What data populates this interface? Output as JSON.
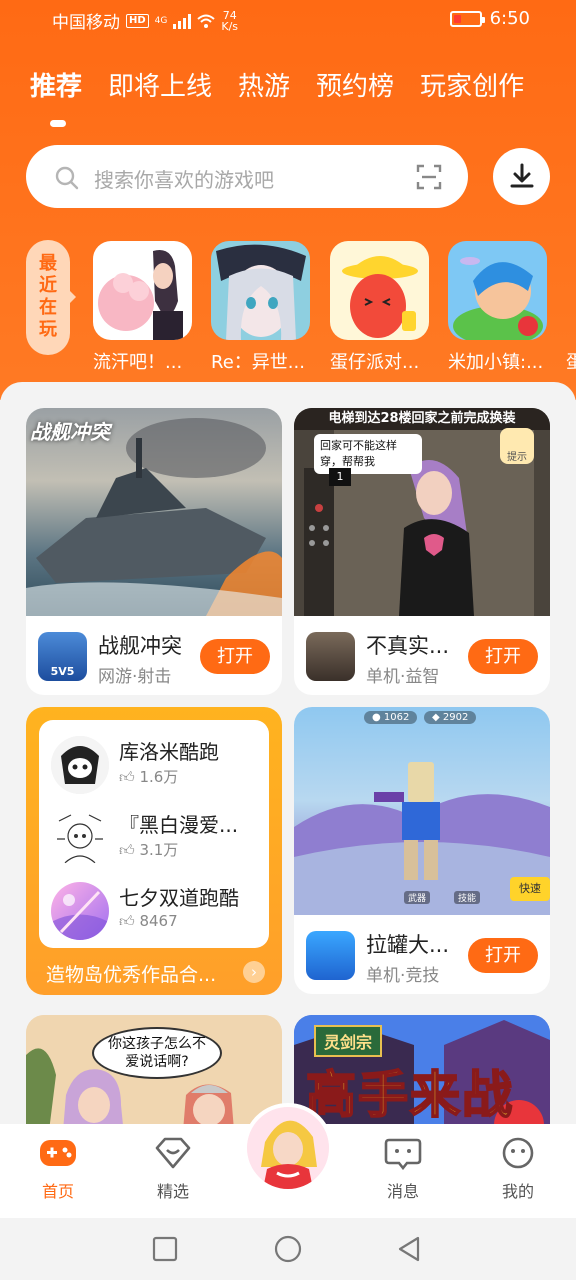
{
  "status_bar": {
    "carrier": "中国移动",
    "hd": "HD",
    "network": "4G",
    "speed_value": "74",
    "speed_unit": "K/s",
    "time": "6:50"
  },
  "tabs": [
    {
      "label": "推荐",
      "active": true
    },
    {
      "label": "即将上线",
      "active": false
    },
    {
      "label": "热游",
      "active": false
    },
    {
      "label": "预约榜",
      "active": false
    },
    {
      "label": "玩家创作",
      "active": false
    }
  ],
  "search": {
    "placeholder": "搜索你喜欢的游戏吧"
  },
  "recent": {
    "label": "最近在玩",
    "games": [
      {
        "name": "流汗吧！..."
      },
      {
        "name": "Re：异世..."
      },
      {
        "name": "蛋仔派对..."
      },
      {
        "name": "米加小镇:..."
      },
      {
        "name": "蛋"
      }
    ]
  },
  "cards": [
    {
      "banner_title": "战舰冲突",
      "name": "战舰冲突",
      "tag": "网游·射击",
      "button": "打开",
      "icon_label": "5V5"
    },
    {
      "banner_title": "电梯到达28楼回家之前完成换装",
      "bubble": "回家可不能这样穿，帮帮我",
      "floor": "1",
      "hint_label": "提示",
      "name": "不真实...",
      "tag": "单机·益智",
      "button": "打开"
    },
    {
      "name": "拉罐大...",
      "tag": "单机·竞技",
      "button": "打开",
      "hud_coins": "1062",
      "hud_gems": "2902",
      "hud_btn": "快速",
      "hud_a": "武器",
      "hud_b": "技能"
    }
  ],
  "collection": {
    "items": [
      {
        "title": "库洛米酷跑",
        "count": "1.6万"
      },
      {
        "title": "『黑白漫爱...",
        "count": "3.1万"
      },
      {
        "title": "七夕双道跑酷",
        "count": "8467"
      }
    ],
    "footer": "造物岛优秀作品合..."
  },
  "bottom_cards": [
    {
      "bubble": "你这孩子怎么不爱说话啊?"
    },
    {
      "sign": "灵剑宗",
      "headline": "高手来战"
    }
  ],
  "bottom_nav": [
    {
      "label": "首页",
      "active": true
    },
    {
      "label": "精选",
      "active": false
    },
    {
      "label": "消息",
      "active": false
    },
    {
      "label": "我的",
      "active": false
    }
  ],
  "colors": {
    "accent": "#ff6a14",
    "collection": "#ffb31f"
  }
}
